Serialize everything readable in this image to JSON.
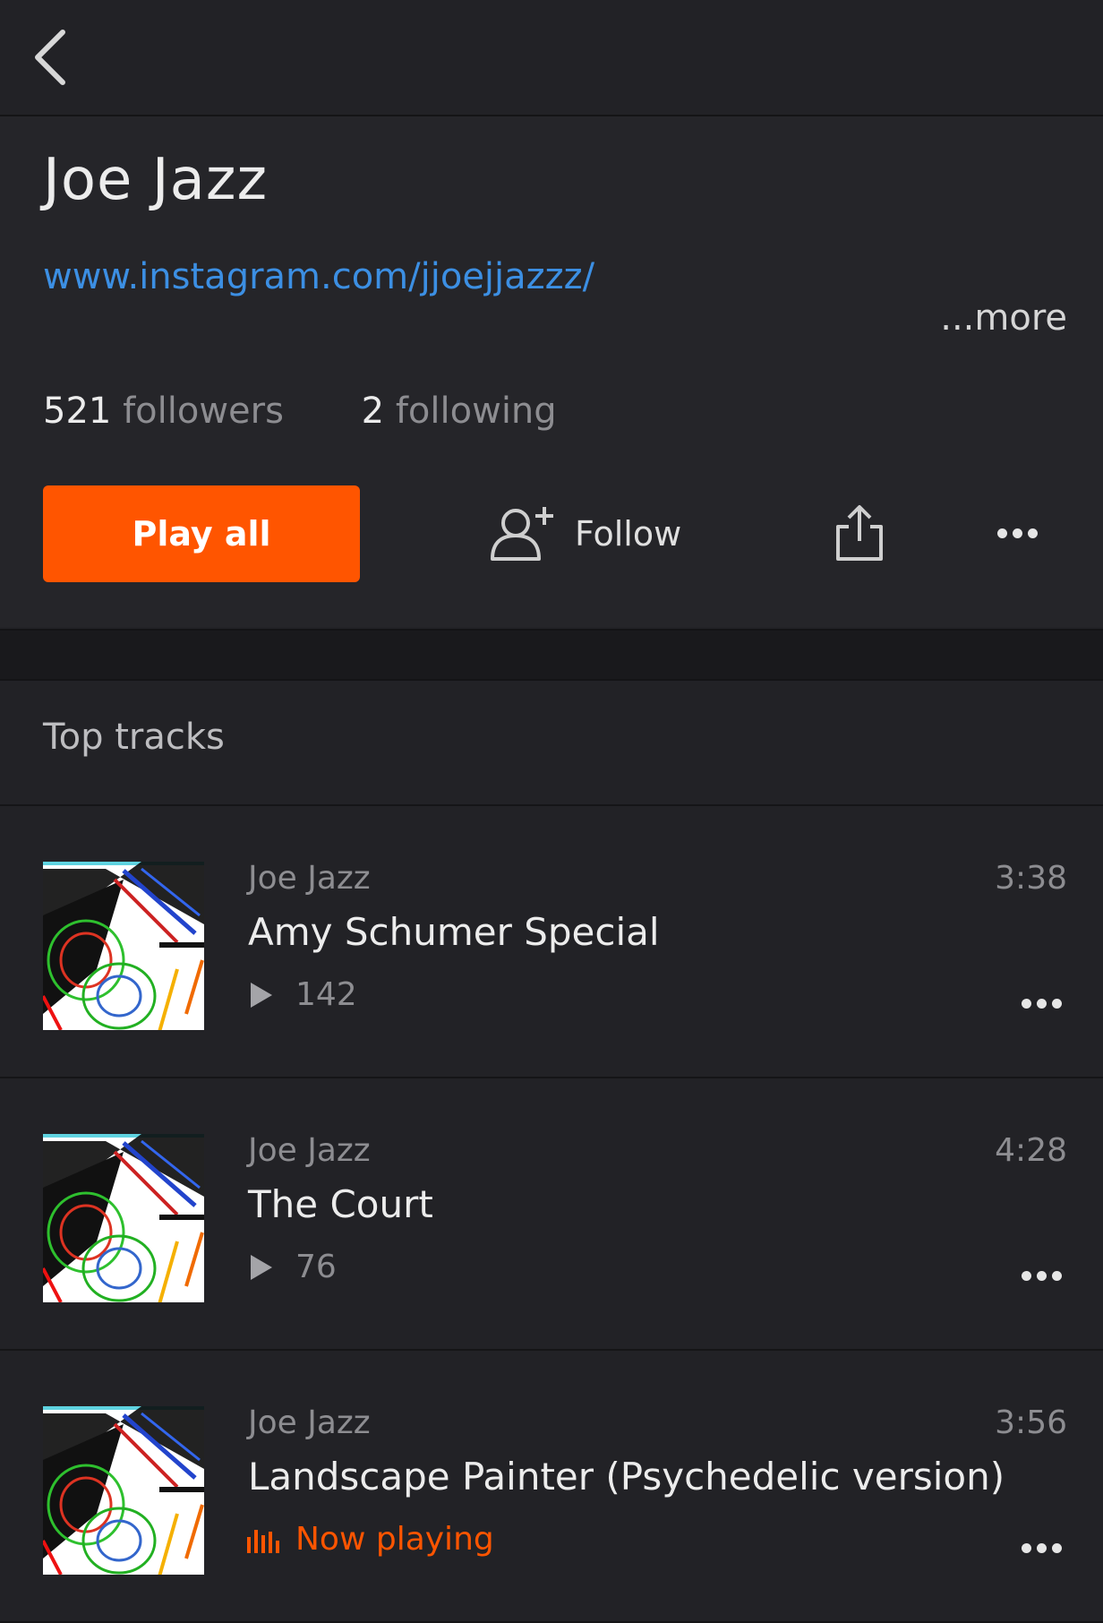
{
  "header": {
    "back_icon": "chevron-left-icon"
  },
  "profile": {
    "name": "Joe Jazz",
    "link": "www.instagram.com/jjoejjazzz/",
    "more_label": "...more",
    "followers_count": "521",
    "followers_label": "followers",
    "following_count": "2",
    "following_label": "following",
    "play_all_label": "Play all",
    "follow_label": "Follow",
    "follow_icon": "add-user-icon",
    "share_icon": "share-icon",
    "more_icon": "more-horizontal-icon"
  },
  "top_tracks": {
    "title": "Top tracks",
    "items": [
      {
        "artist": "Joe Jazz",
        "title": "Amy Schumer Special",
        "duration": "3:38",
        "plays": "142",
        "now_playing": false
      },
      {
        "artist": "Joe Jazz",
        "title": "The Court",
        "duration": "4:28",
        "plays": "76",
        "now_playing": false
      },
      {
        "artist": "Joe Jazz",
        "title": "Landscape Painter (Psychedelic version)",
        "duration": "3:56",
        "now_playing": true,
        "now_playing_label": "Now playing"
      }
    ]
  },
  "colors": {
    "accent": "#ff5500",
    "link": "#3c8fe3",
    "background": "#222226"
  }
}
